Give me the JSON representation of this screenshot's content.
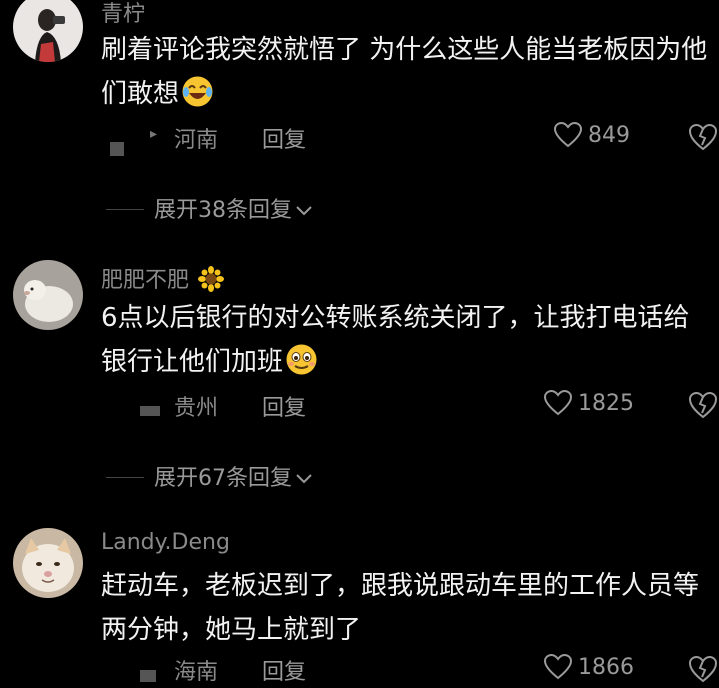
{
  "comments": [
    {
      "username": "青柠",
      "content": "刷着评论我突然就悟了 为什么这些人能当老板因为他们敢想",
      "emoji": "crying-laughing-emoji",
      "location": "河南",
      "reply_label": "回复",
      "likes": "849",
      "expand_label": "展开38条回复"
    },
    {
      "username": "肥肥不肥",
      "username_emoji": "sunflower-emoji",
      "content": "6点以后银行的对公转账系统关闭了，让我打电话给银行让他们加班",
      "emoji": "smiling-emoji",
      "location": "贵州",
      "reply_label": "回复",
      "likes": "1825",
      "expand_label": "展开67条回复"
    },
    {
      "username": "Landy.Deng",
      "content": "赶动车，老板迟到了，跟我说跟动车里的工作人员等两分钟，她马上就到了",
      "location": "海南",
      "reply_label": "回复",
      "likes": "1866"
    }
  ]
}
